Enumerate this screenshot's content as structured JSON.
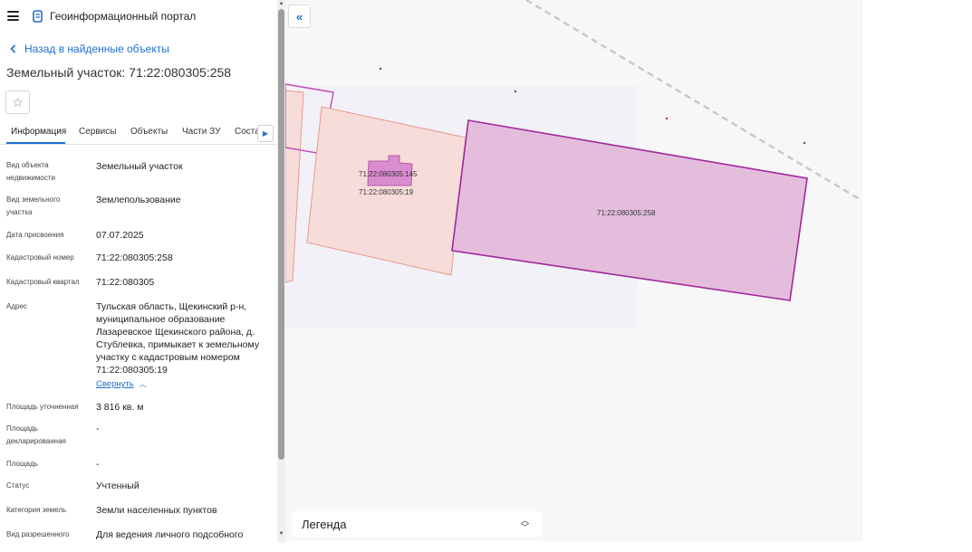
{
  "header": {
    "app_title": "Геоинформационный портал"
  },
  "nav": {
    "back_label": "Назад в найденные объекты"
  },
  "object": {
    "title": "Земельный участок: 71:22:080305:258"
  },
  "tabs": [
    {
      "label": "Информация",
      "active": true
    },
    {
      "label": "Сервисы"
    },
    {
      "label": "Объекты"
    },
    {
      "label": "Части ЗУ"
    },
    {
      "label": "Соста"
    }
  ],
  "properties": [
    {
      "label": "Вид объекта недвижимости",
      "value": "Земельный участок"
    },
    {
      "label": "Вид земельного участка",
      "value": "Землепользование"
    },
    {
      "label": "Дата присвоения",
      "value": "07.07.2025"
    },
    {
      "label": "Кадастровый номер",
      "value": "71:22:080305:258"
    },
    {
      "label": "Кадастровый квартал",
      "value": "71:22:080305"
    },
    {
      "label": "Адрес",
      "value": "Тульская область, Щекинский р-н, муниципальное образование Лазаревское Щекинского района, д. Стублевка, примыкает к земельному участку с кадастровым номером 71:22:080305:19"
    },
    {
      "label": "Площадь уточненная",
      "value": "3 816 кв. м"
    },
    {
      "label": "Площадь декларированная",
      "value": "-"
    },
    {
      "label": "Площадь",
      "value": "-"
    },
    {
      "label": "Статус",
      "value": "Учтенный"
    },
    {
      "label": "Категория земель",
      "value": "Земли населенных пунктов"
    },
    {
      "label": "Вид разрешенного",
      "value": "Для ведения личного подсобного"
    }
  ],
  "address_toggle": "Свернуть",
  "map": {
    "parcel_labels": {
      "small_145": "71:22:080305:145",
      "parcel_19": "71:22:080305:19",
      "parcel_258": "71:22:080305:258"
    },
    "legend_label": "Легенда",
    "colors": {
      "selected_fill": "#e4bddd",
      "selected_stroke": "#a0289b",
      "neighbor_fill": "#f6ddd9",
      "neighbor_stroke": "#e8998f",
      "building_fill": "#d98ccf",
      "accent": "#1f6fd1"
    }
  }
}
